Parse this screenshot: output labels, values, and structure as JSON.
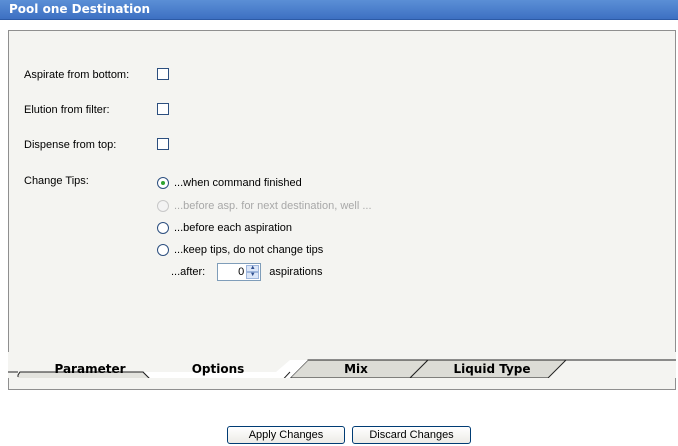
{
  "window": {
    "title": "Pool one Destination"
  },
  "options": {
    "aspirate_from_bottom": {
      "label": "Aspirate from bottom:",
      "checked": false
    },
    "elution_from_filter": {
      "label": "Elution from filter:",
      "checked": false
    },
    "dispense_from_top": {
      "label": "Dispense from top:",
      "checked": false
    }
  },
  "change_tips": {
    "label": "Change Tips:",
    "choices": [
      {
        "label": "...when command finished",
        "selected": true,
        "enabled": true
      },
      {
        "label": "...before asp. for next destination, well ...",
        "selected": false,
        "enabled": false
      },
      {
        "label": "...before each aspiration",
        "selected": false,
        "enabled": true
      },
      {
        "label": "...keep tips, do not change tips",
        "selected": false,
        "enabled": true
      }
    ],
    "after_label": "...after:",
    "after_value": "0",
    "after_unit": "aspirations"
  },
  "tabs": [
    {
      "label": "Parameter",
      "active": false
    },
    {
      "label": "Options",
      "active": true
    },
    {
      "label": "Mix",
      "active": false
    },
    {
      "label": "Liquid Type",
      "active": false
    }
  ],
  "buttons": {
    "apply": "Apply Changes",
    "discard": "Discard Changes"
  }
}
